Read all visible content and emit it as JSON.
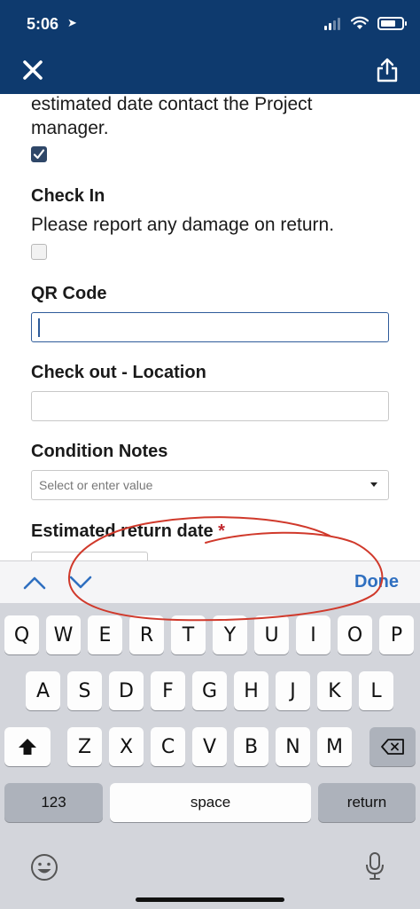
{
  "status_bar": {
    "time": "5:06"
  },
  "form": {
    "intro_line1": "estimated date contact the Project",
    "intro_line2": "manager.",
    "checkin_label": "Check In",
    "checkin_text": "Please report any damage on return.",
    "qr_label": "QR Code",
    "qr_value": "",
    "checkout_label": "Check out -  Location",
    "checkout_value": "",
    "condition_label": "Condition Notes",
    "condition_placeholder": "Select or enter value",
    "return_label": "Estimated return date",
    "required_mark": "*"
  },
  "accessory": {
    "done_label": "Done"
  },
  "keyboard": {
    "row1": [
      "Q",
      "W",
      "E",
      "R",
      "T",
      "Y",
      "U",
      "I",
      "O",
      "P"
    ],
    "row2": [
      "A",
      "S",
      "D",
      "F",
      "G",
      "H",
      "J",
      "K",
      "L"
    ],
    "row3": [
      "Z",
      "X",
      "C",
      "V",
      "B",
      "N",
      "M"
    ],
    "numbers_label": "123",
    "space_label": "space",
    "return_label": "return"
  },
  "colors": {
    "header": "#0e3a6e",
    "accent": "#2f6fc0",
    "required": "#c0272d",
    "annotation": "#d0392b"
  },
  "icons": [
    "close-icon",
    "share-icon",
    "chevron-up-icon",
    "chevron-down-icon",
    "shift-icon",
    "backspace-icon",
    "emoji-icon",
    "microphone-icon"
  ]
}
